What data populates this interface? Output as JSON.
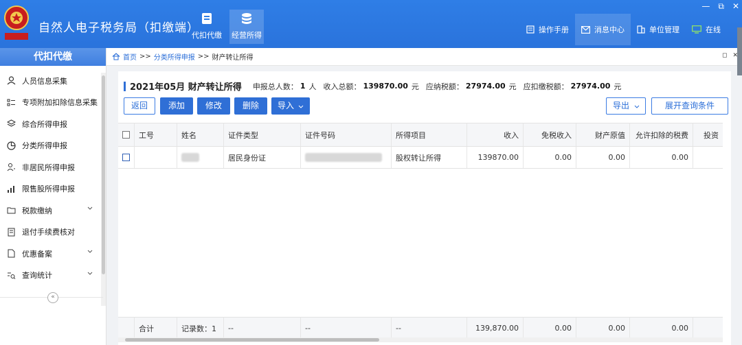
{
  "header": {
    "app_title": "自然人电子税务局（扣缴端）",
    "logo_text": "中国税务",
    "tabs": [
      {
        "label": "代扣代缴",
        "icon": "receipt-icon"
      },
      {
        "label": "经营所得",
        "icon": "coins-icon"
      }
    ],
    "right_items": [
      {
        "label": "操作手册",
        "icon": "manual-icon"
      },
      {
        "label": "消息中心",
        "icon": "mail-icon"
      },
      {
        "label": "单位管理",
        "icon": "building-icon"
      },
      {
        "label": "在线",
        "icon": "monitor-icon"
      }
    ],
    "window_controls": [
      "—",
      "⧉",
      "✕"
    ]
  },
  "sidebar": {
    "title": "代扣代缴",
    "items": [
      {
        "label": "人员信息采集",
        "icon": "person-icon",
        "has_submenu": false
      },
      {
        "label": "专项附加扣除信息采集",
        "icon": "list-icon",
        "has_submenu": false
      },
      {
        "label": "综合所得申报",
        "icon": "layers-icon",
        "has_submenu": false
      },
      {
        "label": "分类所得申报",
        "icon": "pie-icon",
        "has_submenu": false
      },
      {
        "label": "非居民所得申报",
        "icon": "user-icon",
        "has_submenu": false
      },
      {
        "label": "限售股所得申报",
        "icon": "bar-chart-icon",
        "has_submenu": false
      },
      {
        "label": "税款缴纳",
        "icon": "folder-icon",
        "has_submenu": true
      },
      {
        "label": "退付手续费核对",
        "icon": "document-icon",
        "has_submenu": false
      },
      {
        "label": "优惠备案",
        "icon": "file-icon",
        "has_submenu": true
      },
      {
        "label": "查询统计",
        "icon": "search-list-icon",
        "has_submenu": true
      }
    ],
    "collapse_label": "«"
  },
  "breadcrumb": {
    "home": "首页",
    "sep": ">>",
    "level1": "分类所得申报",
    "current": "财产转让所得"
  },
  "summary": {
    "title": "2021年05月  财产转让所得",
    "count_label": "申报总人数：",
    "count_value": "1",
    "count_unit": "人",
    "income_label": "收入总额：",
    "income_value": "139870.00",
    "income_unit": "元",
    "tax_label": "应纳税额：",
    "tax_value": "27974.00",
    "tax_unit": "元",
    "withhold_label": "应扣缴税额：",
    "withhold_value": "27974.00",
    "withhold_unit": "元"
  },
  "toolbar": {
    "back": "返回",
    "add": "添加",
    "edit": "修改",
    "delete": "删除",
    "import": "导入",
    "export": "导出",
    "expand_query": "展开查询条件"
  },
  "table": {
    "columns": [
      "工号",
      "姓名",
      "证件类型",
      "证件号码",
      "所得项目",
      "收入",
      "免税收入",
      "财产原值",
      "允许扣除的税费",
      "投资"
    ],
    "rows": [
      {
        "id": "",
        "name": "",
        "id_type": "居民身份证",
        "id_number": "",
        "item": "股权转让所得",
        "income": "139870.00",
        "tax_free": "0.00",
        "original_value": "0.00",
        "deductible": "0.00"
      }
    ],
    "footer": {
      "label": "合计",
      "records": "记录数：1",
      "id_type": "--",
      "id_number": "--",
      "item": "--",
      "income": "139,870.00",
      "tax_free": "0.00",
      "original_value": "0.00",
      "deductible": "0.00"
    }
  }
}
